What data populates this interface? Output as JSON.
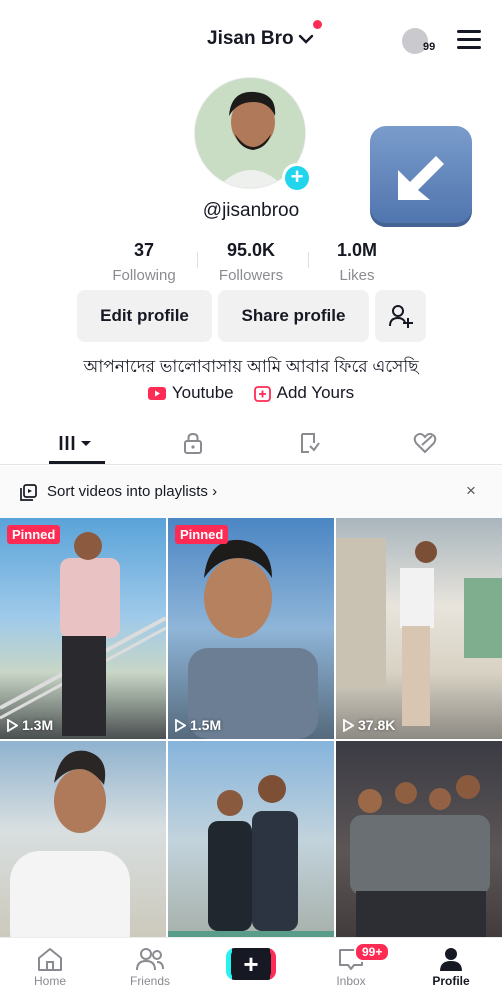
{
  "header": {
    "username": "Jisan Bro",
    "profile_views": "99"
  },
  "profile": {
    "handle": "@jisanbroo",
    "stats": [
      {
        "value": "37",
        "label": "Following"
      },
      {
        "value": "95.0K",
        "label": "Followers"
      },
      {
        "value": "1.0M",
        "label": "Likes"
      }
    ],
    "edit_profile": "Edit profile",
    "share_profile": "Share profile",
    "bio": "আপনাদের ভালোবাসায় আমি আবার ফিরে এসেছি",
    "links": [
      {
        "label": "Youtube",
        "icon": "youtube-icon"
      },
      {
        "label": "Add Yours",
        "icon": "add-yours-icon"
      }
    ]
  },
  "tabs": [
    "videos-grid-icon",
    "private-lock-icon",
    "reposts-icon",
    "liked-icon"
  ],
  "sortbar": {
    "text": "Sort videos into playlists ›",
    "close": "×"
  },
  "videos": [
    {
      "pinned": "Pinned",
      "views": "1.3M"
    },
    {
      "pinned": "Pinned",
      "views": "1.5M"
    },
    {
      "pinned": "",
      "views": "37.8K"
    },
    {
      "pinned": "",
      "views": ""
    },
    {
      "pinned": "",
      "views": ""
    },
    {
      "pinned": "",
      "views": ""
    }
  ],
  "nav": {
    "home": "Home",
    "friends": "Friends",
    "inbox": "Inbox",
    "inbox_badge": "99+",
    "profile": "Profile"
  },
  "colors": {
    "accent": "#fe2c55",
    "cyan": "#20d5ec",
    "text": "#161823",
    "muted": "#8a8b91"
  }
}
